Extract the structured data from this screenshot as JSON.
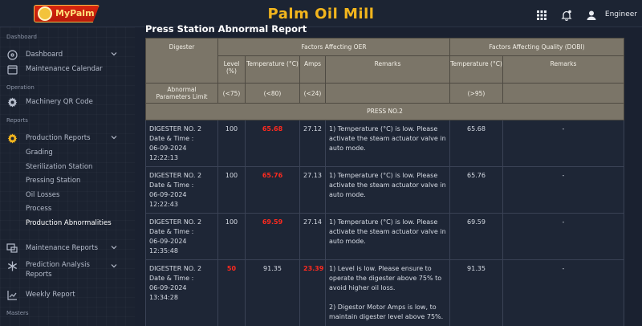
{
  "header": {
    "logo_text": "MyPalm",
    "title": "Palm Oil Mill",
    "user": "Engineer",
    "icons": [
      "apps-grid-icon",
      "bell-icon",
      "user-icon"
    ]
  },
  "sidebar": {
    "sections": {
      "dashboard": "Dashboard",
      "operation": "Operation",
      "reports": "Reports",
      "masters": "Masters"
    },
    "items": {
      "dashboard": "Dashboard",
      "maintenance_calendar": "Maintenance Calendar",
      "machinery_qr": "Machinery QR Code",
      "production_reports": "Production Reports",
      "maintenance_reports": "Maintenance Reports",
      "prediction_analysis": "Prediction Analysis Reports",
      "weekly_report": "Weekly Report"
    },
    "production_sub": [
      "Grading",
      "Sterilization Station",
      "Pressing Station",
      "Oil Losses",
      "Process",
      "Production Abnormalities"
    ]
  },
  "report": {
    "title": "Press Station Abnormal Report",
    "headers": {
      "digester": "Digester",
      "oer_group": "Factors Affecting OER",
      "dobi_group": "Factors Affecting Quality (DOBI)",
      "level": "Level (%)",
      "temperature": "Temperature (°C)",
      "amps": "Amps",
      "remarks": "Remarks",
      "temperature_dobi": "Temperature (°C)",
      "remarks_dobi": "Remarks",
      "abnormal_limit": "Abnormal Parameters Limit",
      "limit_level": "(<75)",
      "limit_temp": "(<80)",
      "limit_amps": "(<24)",
      "limit_temp_dobi": "(>95)"
    },
    "press_label": "PRESS NO.2",
    "rows": [
      {
        "digester": "DIGESTER NO. 2",
        "date_label": "Date & Time :",
        "date": "06-09-2024",
        "time": "12:22:13",
        "level": "100",
        "temp": "65.68",
        "amps": "27.12",
        "remarks": "1) Temperature (°C) is low. Please activate the steam actuator valve in auto mode.",
        "remarks2": "",
        "temp_dobi": "65.68",
        "remarks_dobi": "-"
      },
      {
        "digester": "DIGESTER NO. 2",
        "date_label": "Date & Time :",
        "date": "06-09-2024",
        "time": "12:22:43",
        "level": "100",
        "temp": "65.76",
        "amps": "27.13",
        "remarks": "1) Temperature (°C) is low. Please activate the steam actuator valve in auto mode.",
        "remarks2": "",
        "temp_dobi": "65.76",
        "remarks_dobi": "-"
      },
      {
        "digester": "DIGESTER NO. 2",
        "date_label": "Date & Time :",
        "date": "06-09-2024",
        "time": "12:35:48",
        "level": "100",
        "temp": "69.59",
        "amps": "27.14",
        "remarks": "1) Temperature (°C) is low. Please activate the steam actuator valve in auto mode.",
        "remarks2": "",
        "temp_dobi": "69.59",
        "remarks_dobi": "-"
      },
      {
        "digester": "DIGESTER NO. 2",
        "date_label": "Date & Time :",
        "date": "06-09-2024",
        "time": "13:34:28",
        "level": "50",
        "temp": "91.35",
        "amps": "23.39",
        "remarks": "1) Level is low. Please ensure to operate the digester above 75% to avoid higher oil loss.",
        "remarks2": "2) Digestor Motor Amps is low, to maintain digester level above 75%.",
        "temp_dobi": "91.35",
        "remarks_dobi": "-"
      }
    ]
  },
  "colors": {
    "accent": "#f2b51d",
    "alert": "#ff2a1f",
    "header_bg": "#7b7568",
    "page_bg": "#1a2130"
  }
}
